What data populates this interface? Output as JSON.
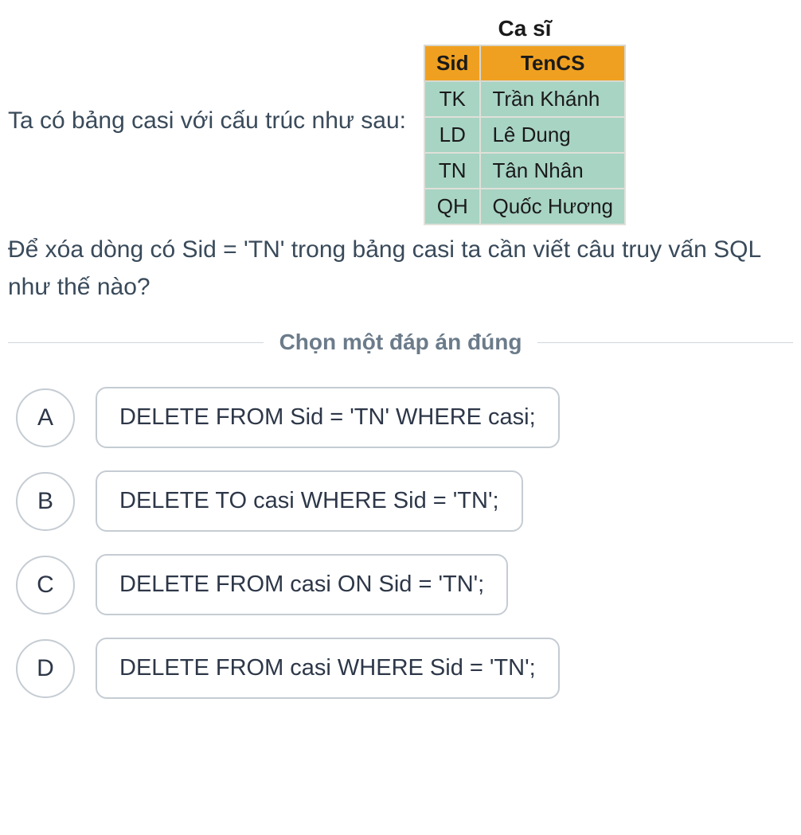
{
  "intro": "Ta có bảng casi với cấu trúc như sau:",
  "table": {
    "title": "Ca sĩ",
    "headers": {
      "sid": "Sid",
      "tencs": "TenCS"
    },
    "rows": [
      {
        "sid": "TK",
        "tencs": "Trần Khánh"
      },
      {
        "sid": "LD",
        "tencs": "Lê Dung"
      },
      {
        "sid": "TN",
        "tencs": "Tân Nhân"
      },
      {
        "sid": "QH",
        "tencs": "Quốc Hương"
      }
    ]
  },
  "question": "Để xóa dòng có Sid = 'TN' trong bảng casi ta cần viết câu truy vấn SQL như thế nào?",
  "prompt": "Chọn một đáp án đúng",
  "options": [
    {
      "letter": "A",
      "text": "DELETE FROM Sid = 'TN' WHERE casi;"
    },
    {
      "letter": "B",
      "text": "DELETE TO casi WHERE Sid = 'TN';"
    },
    {
      "letter": "C",
      "text": "DELETE FROM casi ON Sid = 'TN';"
    },
    {
      "letter": "D",
      "text": "DELETE FROM casi WHERE Sid = 'TN';"
    }
  ]
}
